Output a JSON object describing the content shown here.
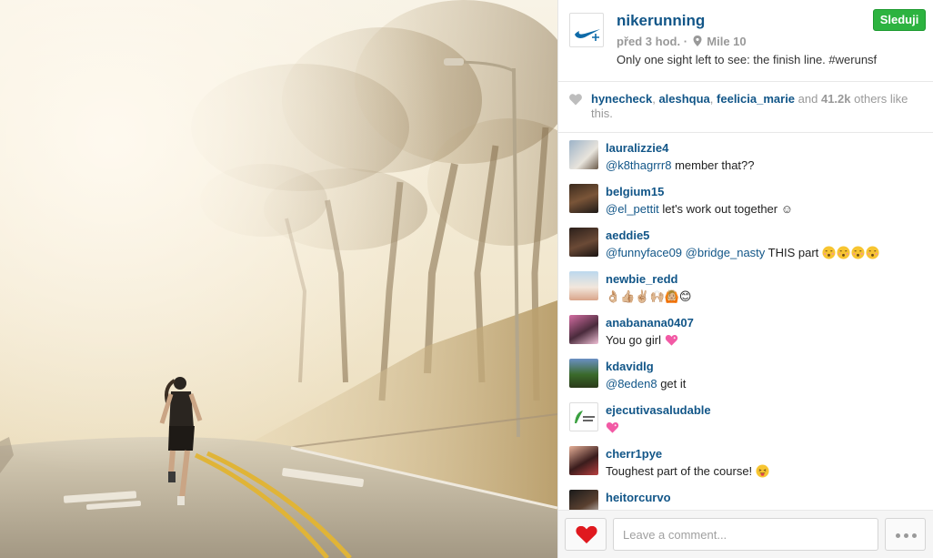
{
  "post": {
    "username": "nikerunning",
    "time": "před 3 hod.",
    "separator": "·",
    "location": "Mile 10",
    "caption": "Only one sight left to see: the finish line. #werunsf",
    "follow_label": "Sleduji",
    "logo_icon": "nike-swoosh-icon"
  },
  "likes": {
    "users": [
      "hynecheck",
      "aleshqua",
      "feelicia_marie"
    ],
    "sep": ", ",
    "and_text": " and ",
    "count": "41.2k",
    "suffix": " others like this."
  },
  "comments": [
    {
      "user": "lauralizzie4",
      "mention": "@k8thagrrr8",
      "text": " member that??"
    },
    {
      "user": "belgium15",
      "mention": "@el_pettit",
      "text": " let's work out together ☺"
    },
    {
      "user": "aeddie5",
      "mention": "@funnyface09",
      "mention2": "@bridge_nasty",
      "text": " THIS part "
    },
    {
      "user": "newbie_redd",
      "text": "👌🏼👍🏼✌🏼🙌🏼🙆🏼😊"
    },
    {
      "user": "anabanana0407",
      "text": "You go girl "
    },
    {
      "user": "kdavidlg",
      "mention": "@8eden8",
      "text": " get it"
    },
    {
      "user": "ejecutivasaludable",
      "text": ""
    },
    {
      "user": "cherr1pye",
      "text": "Toughest part of the course! "
    },
    {
      "user": "heitorcurvo",
      "text": ""
    }
  ],
  "footer": {
    "comment_placeholder": "Leave a comment...",
    "like_icon": "heart-icon",
    "more_icon": "ellipsis-icon"
  },
  "colors": {
    "link": "#125688",
    "follow_green": "#2db340",
    "heart_red": "#e0191f"
  }
}
